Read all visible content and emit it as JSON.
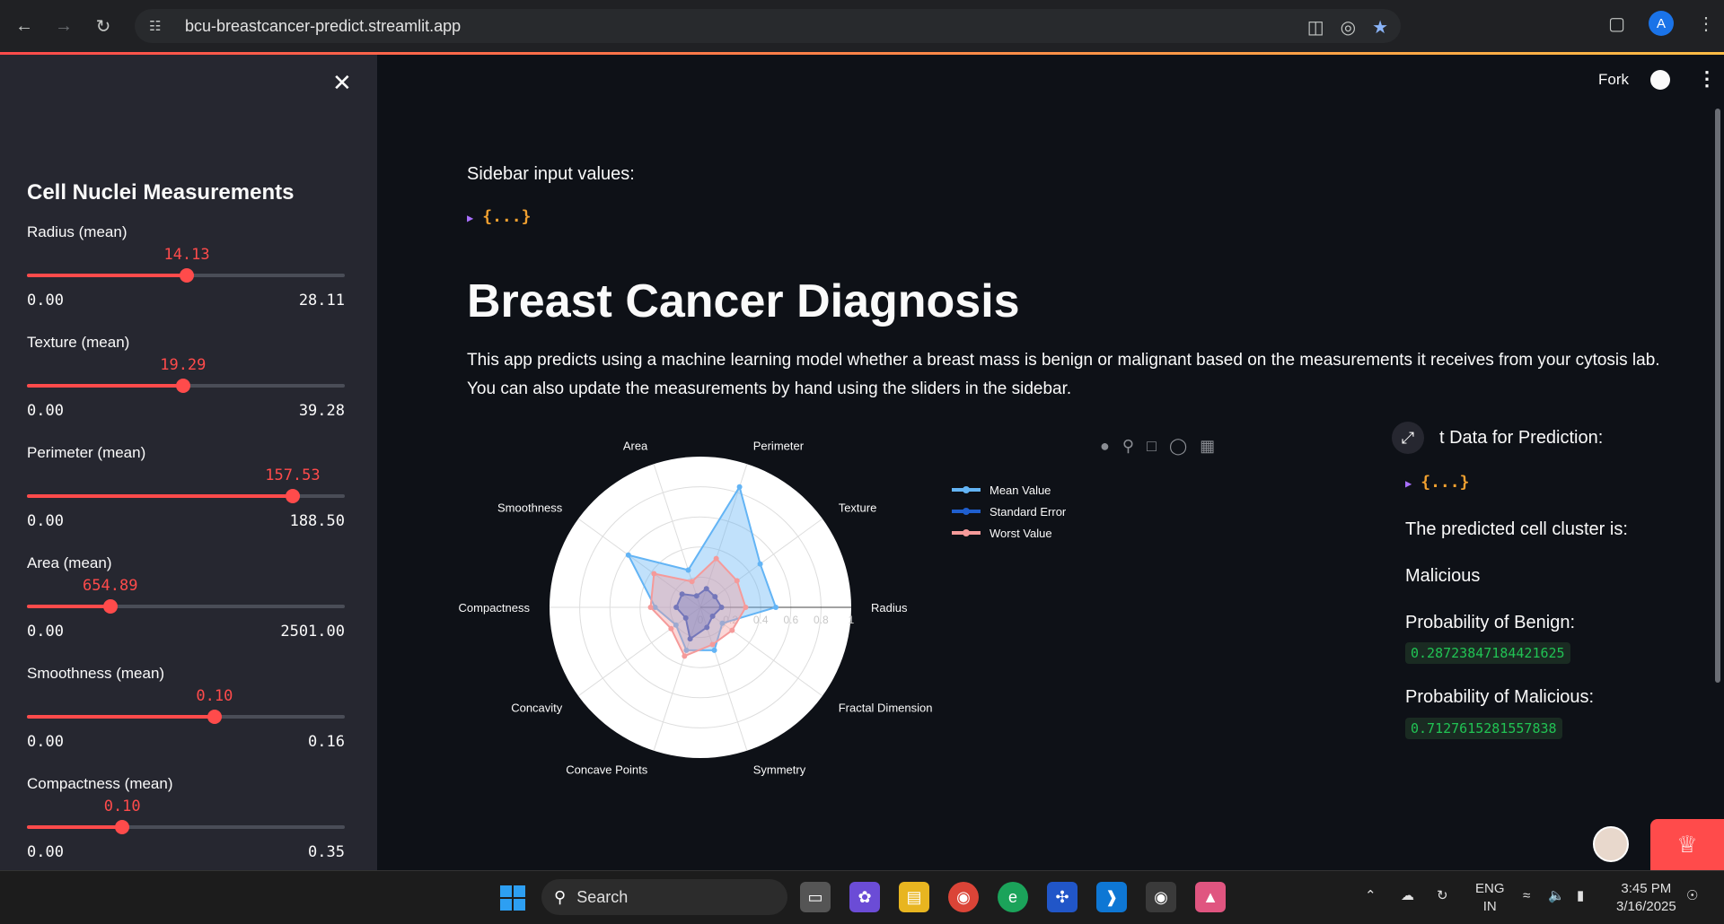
{
  "browser": {
    "url": "bcu-breastcancer-predict.streamlit.app",
    "avatar_letter": "A"
  },
  "sidebar": {
    "title": "Cell Nuclei Measurements",
    "sliders": [
      {
        "label": "Radius (mean)",
        "value": "14.13",
        "min": "0.00",
        "max": "28.11",
        "fraction": 0.503
      },
      {
        "label": "Texture (mean)",
        "value": "19.29",
        "min": "0.00",
        "max": "39.28",
        "fraction": 0.491
      },
      {
        "label": "Perimeter (mean)",
        "value": "157.53",
        "min": "0.00",
        "max": "188.50",
        "fraction": 0.836
      },
      {
        "label": "Area (mean)",
        "value": "654.89",
        "min": "0.00",
        "max": "2501.00",
        "fraction": 0.262
      },
      {
        "label": "Smoothness (mean)",
        "value": "0.10",
        "min": "0.00",
        "max": "0.16",
        "fraction": 0.59
      },
      {
        "label": "Compactness (mean)",
        "value": "0.10",
        "min": "0.00",
        "max": "0.35",
        "fraction": 0.3
      }
    ]
  },
  "header": {
    "fork_label": "Fork"
  },
  "main": {
    "input_heading": "Sidebar input values:",
    "json_collapsed": "{...}",
    "title": "Breast Cancer Diagnosis",
    "description": "This app predicts using a machine learning model whether a breast mass is benign or malignant based on the measurements it receives from your cytosis lab. You can also update the measurements by hand using the sliders in the sidebar."
  },
  "prediction": {
    "input_heading_partial": "t Data for Prediction:",
    "json_collapsed": "{...}",
    "cluster_heading": "The predicted cell cluster is:",
    "cluster_value": "Malicious",
    "benign_heading": "Probability of Benign:",
    "benign_value": "0.28723847184421625",
    "malicious_heading": "Probability of Malicious:",
    "malicious_value": "0.7127615281557838"
  },
  "chart_data": {
    "type": "radar",
    "categories": [
      "Radius",
      "Texture",
      "Perimeter",
      "Area",
      "Smoothness",
      "Compactness",
      "Concavity",
      "Concave Points",
      "Symmetry",
      "Fractal Dimension"
    ],
    "radial_ticks": [
      "0",
      "0.2",
      "0.4",
      "0.6",
      "0.8",
      "1"
    ],
    "radial_range": [
      0,
      1
    ],
    "legend_placement": "right",
    "series": [
      {
        "name": "Mean Value",
        "color": "#63b4f5",
        "values": [
          0.5,
          0.49,
          0.84,
          0.26,
          0.59,
          0.3,
          0.2,
          0.3,
          0.3,
          0.18
        ]
      },
      {
        "name": "Standard Error",
        "color": "#1f5fcf",
        "values": [
          0.14,
          0.12,
          0.13,
          0.08,
          0.15,
          0.16,
          0.12,
          0.22,
          0.14,
          0.1
        ]
      },
      {
        "name": "Worst Value",
        "color": "#f59a9a",
        "values": [
          0.3,
          0.3,
          0.34,
          0.18,
          0.38,
          0.33,
          0.24,
          0.34,
          0.26,
          0.26
        ]
      }
    ]
  },
  "taskbar": {
    "search_label": "Search",
    "lang_top": "ENG",
    "lang_bottom": "IN",
    "time": "3:45 PM",
    "date": "3/16/2025"
  }
}
